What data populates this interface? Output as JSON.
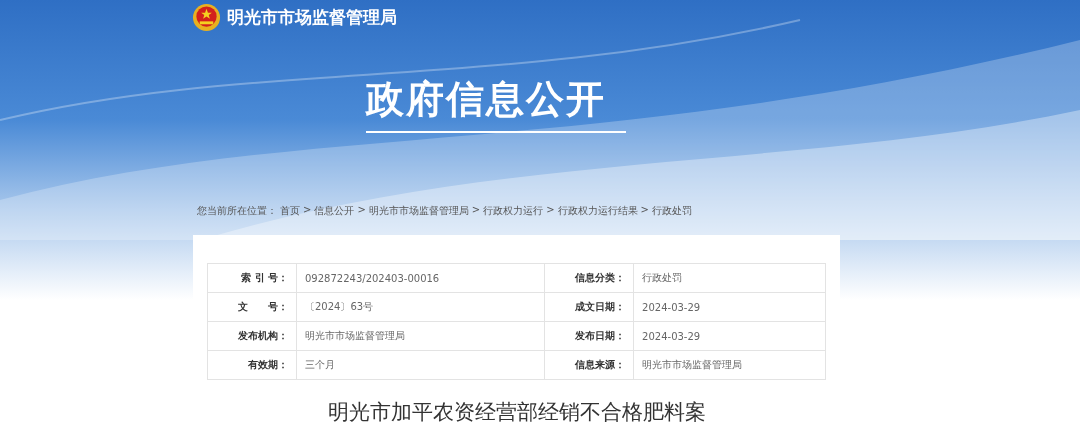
{
  "header": {
    "site_name": "明光市市场监督管理局",
    "banner_title": "政府信息公开"
  },
  "breadcrumb": {
    "label": "您当前所在位置：",
    "separator": ">",
    "items": [
      {
        "text": "首页"
      },
      {
        "text": "信息公开"
      },
      {
        "text": "明光市市场监督管理局"
      },
      {
        "text": "行政权力运行"
      },
      {
        "text": "行政权力运行结果"
      },
      {
        "text": "行政处罚"
      }
    ]
  },
  "info_table": {
    "rows": [
      [
        {
          "label": "索 引 号：",
          "value": "092872243/202403-00016"
        },
        {
          "label": "信息分类：",
          "value": "行政处罚"
        }
      ],
      [
        {
          "label": "文　　号：",
          "value": "〔2024〕63号"
        },
        {
          "label": "成文日期：",
          "value": "2024-03-29"
        }
      ],
      [
        {
          "label": "发布机构：",
          "value": "明光市市场监督管理局"
        },
        {
          "label": "发布日期：",
          "value": "2024-03-29"
        }
      ],
      [
        {
          "label": "有效期：",
          "value": "三个月"
        },
        {
          "label": "信息来源：",
          "value": "明光市市场监督管理局"
        }
      ]
    ]
  },
  "article": {
    "title": "明光市加平农资经营部经销不合格肥料案"
  }
}
